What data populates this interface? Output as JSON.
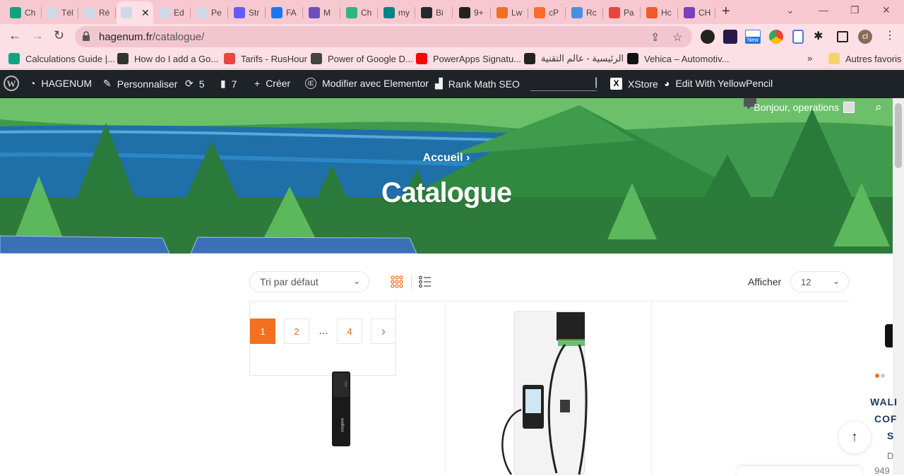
{
  "browser": {
    "tabs": [
      {
        "label": "Ch",
        "color": "#10a37f"
      },
      {
        "label": "Tél",
        "color": "#d0d8e8"
      },
      {
        "label": "Ré",
        "color": "#d0d8e8"
      },
      {
        "label": "",
        "color": "#d0d8e8",
        "active": true
      },
      {
        "label": "Ed",
        "color": "#d0d8e8"
      },
      {
        "label": "Pe",
        "color": "#d0d8e8"
      },
      {
        "label": "Str",
        "color": "#635bff"
      },
      {
        "label": "FA",
        "color": "#1877f2"
      },
      {
        "label": "M",
        "color": "#6b4fbb"
      },
      {
        "label": "Ch",
        "color": "#2fb57f"
      },
      {
        "label": "my",
        "color": "#038387"
      },
      {
        "label": "Bi",
        "color": "#24292f"
      },
      {
        "label": "9+",
        "color": "#222222"
      },
      {
        "label": "Lw",
        "color": "#f37021"
      },
      {
        "label": "cP",
        "color": "#ff6c2c"
      },
      {
        "label": "Rc",
        "color": "#4a90d9"
      },
      {
        "label": "Pa",
        "color": "#e8453c"
      },
      {
        "label": "Hc",
        "color": "#f05a28"
      },
      {
        "label": "CH",
        "color": "#7a3fc0"
      }
    ],
    "tab_close": "✕",
    "new_tab": "+",
    "url_domain": "hagenum.fr",
    "url_path": "/catalogue/",
    "profile_initial": "cl",
    "new_badge": "New",
    "bookmarks": [
      {
        "label": "Calculations Guide |...",
        "color": "#10a37f"
      },
      {
        "label": "How do I add a Go...",
        "color": "#333333"
      },
      {
        "label": "Tarifs - RusHour",
        "color": "#e8453c"
      },
      {
        "label": "Power of Google D...",
        "color": "#444444"
      },
      {
        "label": "PowerApps Signatu...",
        "color": "#ff0000"
      },
      {
        "label": "الرئيسية - عالم التقنية",
        "color": "#222222"
      },
      {
        "label": "Vehica – Automotiv...",
        "color": "#111111"
      }
    ],
    "bookmarks_more": "»",
    "other_bookmarks": "Autres favoris"
  },
  "wp_admin_bar": {
    "site_name": "HAGENUM",
    "customize": "Personnaliser",
    "updates": "5",
    "comments": "7",
    "new": "Créer",
    "elementor": "Modifier avec Elementor",
    "rankmath": "Rank Math SEO",
    "xstore": "XStore",
    "yellowpencil": "Edit With YellowPencil"
  },
  "hero": {
    "breadcrumb": "Accueil",
    "breadcrumb_sep": "›",
    "title": "Catalogue",
    "greeting": "Bonjour, operations"
  },
  "toolbar": {
    "sort_label": "Tri par défaut",
    "show_label": "Afficher",
    "per_page": "12"
  },
  "pagination": {
    "pages": [
      "1",
      "2",
      "...",
      "4"
    ],
    "current": "1",
    "next": "›"
  },
  "side_product": {
    "title_lines": [
      "WALI",
      "COF",
      "S"
    ],
    "sub_lines": [
      "D",
      "949"
    ]
  },
  "colors": {
    "accent": "#f37021",
    "wp_bar": "#1d2327",
    "tab_strip": "#f8c8d0",
    "chrome_bg": "#fde0e6"
  },
  "icons": {
    "back": "back-arrow-icon",
    "forward": "forward-arrow-icon",
    "reload": "reload-icon",
    "share": "share-icon",
    "star": "star-icon",
    "extensions": "puzzle-icon",
    "grid": "grid-view-icon",
    "list": "list-view-icon",
    "scroll_top": "arrow-up-icon"
  }
}
